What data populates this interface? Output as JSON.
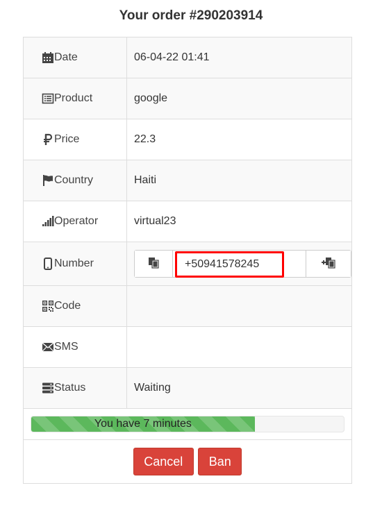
{
  "title": "Your order #290203914",
  "rows": {
    "date": {
      "label": "Date",
      "value": "06-04-22 01:41",
      "icon": "calendar-icon"
    },
    "product": {
      "label": "Product",
      "value": "google",
      "icon": "list-icon"
    },
    "price": {
      "label": "Price",
      "value": "22.3",
      "icon": "ruble-icon"
    },
    "country": {
      "label": "Country",
      "value": "Haiti",
      "icon": "flag-icon"
    },
    "operator": {
      "label": "Operator",
      "value": "virtual23",
      "icon": "signal-icon"
    },
    "number": {
      "label": "Number",
      "value": "+50941578245",
      "icon": "mobile-phone-icon",
      "left_button_icon": "copy-icon",
      "right_button_icon": "plus-copy-icon"
    },
    "code": {
      "label": "Code",
      "value": "",
      "icon": "qr-code-icon"
    },
    "sms": {
      "label": "SMS",
      "value": "",
      "icon": "envelope-icon"
    },
    "status": {
      "label": "Status",
      "value": "Waiting",
      "icon": "server-icon"
    }
  },
  "progress": {
    "text": "You have 7 minutes",
    "fraction": 0.715,
    "color": "#5cb85c"
  },
  "buttons": {
    "cancel_label": "Cancel",
    "ban_label": "Ban",
    "color": "#d9433a"
  },
  "colors": {
    "highlight_border": "#ff0000",
    "stripe": "#f9f9f9",
    "border": "#dddddd"
  }
}
